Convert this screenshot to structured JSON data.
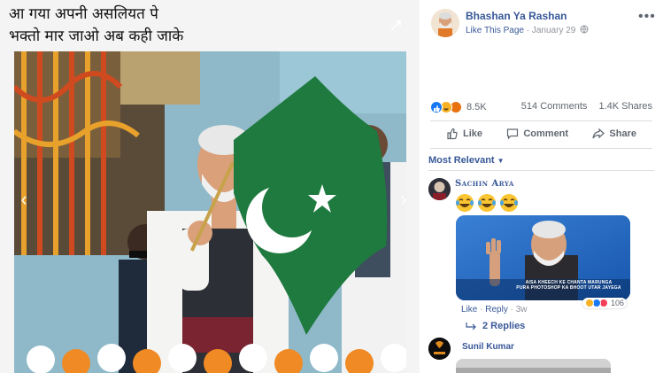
{
  "post": {
    "caption_line1": "आ गया अपनी असलियत पे",
    "caption_line2": "भक्तो मार जाओ अब कही जाके"
  },
  "page": {
    "name": "Bhashan Ya Rashan",
    "like_link": "Like This Page",
    "separator": "·",
    "date": "January 29",
    "more_glyph": "•••"
  },
  "stats": {
    "reactions_count": "8.5K",
    "comments": "514 Comments",
    "shares": "1.4K Shares"
  },
  "actions": {
    "like": "Like",
    "comment": "Comment",
    "share": "Share"
  },
  "comments_sort": {
    "label": "Most Relevant",
    "caret": "▼"
  },
  "comment1": {
    "author": "Sachin Arya",
    "meme_text_line1": "AISA KHEECH KE CHANTA MARUNGA",
    "meme_text_line2": "PURA PHOTOSHOP KA BHOOT UTAR JAYEGA",
    "like": "Like",
    "reply": "Reply",
    "time": "3w",
    "dot": "·",
    "reaction_count": "106",
    "replies": "2 Replies"
  },
  "comment2": {
    "author": "Sunil Kumar"
  },
  "colors": {
    "link_blue": "#385898",
    "muted_gray": "#606770",
    "flag_green": "#1f7a3f",
    "like_blue": "#1877f2",
    "love_red": "#f33e58",
    "haha_yellow": "#f7b125"
  }
}
